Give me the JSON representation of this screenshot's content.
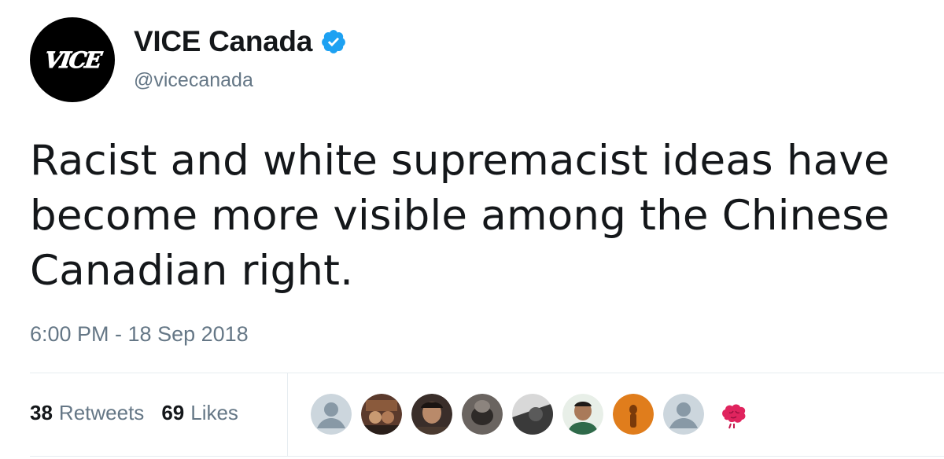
{
  "account": {
    "display_name": "VICE Canada",
    "handle": "@vicecanada",
    "avatar_logo_text": "VICE",
    "verified": true
  },
  "tweet": {
    "text": "Racist and white supremacist ideas have become more visible among the Chinese Canadian right.",
    "timestamp": "6:00 PM - 18 Sep 2018"
  },
  "stats": {
    "retweets_count": "38",
    "retweets_label": "Retweets",
    "likes_count": "69",
    "likes_label": "Likes"
  },
  "likers": [
    {
      "icon": "default-profile-icon",
      "color": "#aab8c2"
    },
    {
      "icon": "profile-photo",
      "color": "#6b4a3a"
    },
    {
      "icon": "profile-photo",
      "color": "#3a2e2a"
    },
    {
      "icon": "profile-photo",
      "color": "#4a4542"
    },
    {
      "icon": "profile-photo",
      "color": "#5a5a5a"
    },
    {
      "icon": "profile-photo",
      "color": "#2f4a3a"
    },
    {
      "icon": "profile-photo",
      "color": "#d97a1e"
    },
    {
      "icon": "default-profile-icon",
      "color": "#aab8c2"
    },
    {
      "icon": "brain-icon",
      "color": "#e0245e"
    }
  ],
  "colors": {
    "verified_blue": "#1da1f2",
    "text_primary": "#14171a",
    "text_secondary": "#657786",
    "divider": "#e6ecf0"
  }
}
